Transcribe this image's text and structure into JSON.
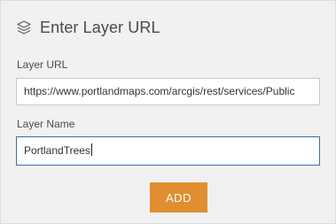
{
  "dialog": {
    "title": "Enter Layer URL",
    "title_icon": "layers-icon"
  },
  "form": {
    "url_label": "Layer URL",
    "url_value": "https://www.portlandmaps.com/arcgis/rest/services/Public",
    "name_label": "Layer Name",
    "name_value": "PortlandTrees",
    "add_label": "ADD"
  },
  "colors": {
    "panel_background": "#f1f1f1",
    "button": "#e08e30",
    "focused_border": "#3b6fa5"
  }
}
